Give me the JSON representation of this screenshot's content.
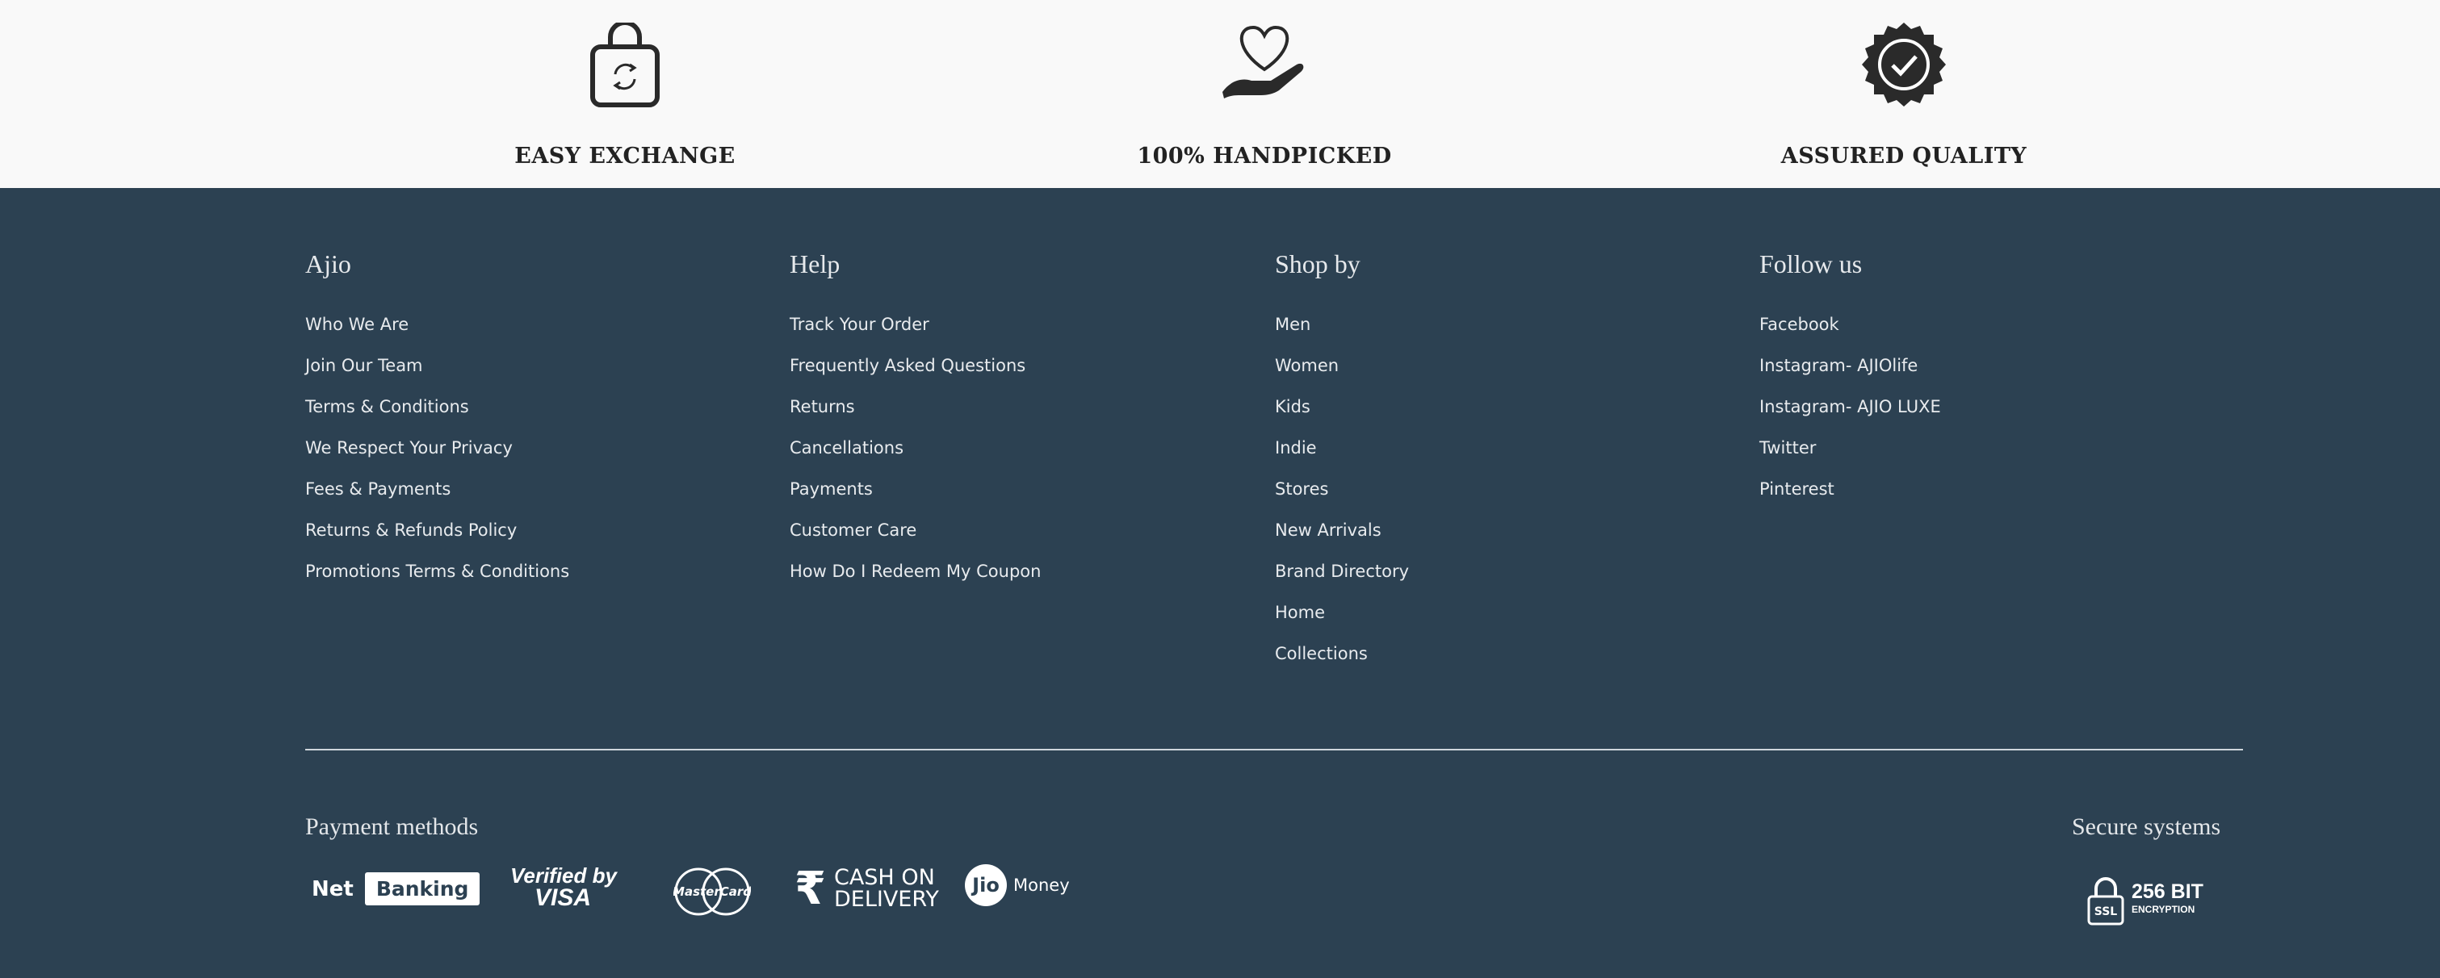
{
  "features": [
    {
      "label": "EASY EXCHANGE",
      "icon": "shopping-bag-exchange-icon"
    },
    {
      "label": "100% HANDPICKED",
      "icon": "heart-in-hand-icon"
    },
    {
      "label": "ASSURED QUALITY",
      "icon": "quality-badge-icon"
    }
  ],
  "footer": {
    "columns": [
      {
        "title": "Ajio",
        "items": [
          "Who We Are",
          "Join Our Team",
          "Terms & Conditions",
          "We Respect Your Privacy",
          "Fees & Payments",
          "Returns & Refunds Policy",
          "Promotions Terms & Conditions"
        ]
      },
      {
        "title": "Help",
        "items": [
          "Track Your Order",
          "Frequently Asked Questions",
          "Returns",
          "Cancellations",
          "Payments",
          "Customer Care",
          "How Do I Redeem My Coupon"
        ]
      },
      {
        "title": "Shop by",
        "items": [
          "Men",
          "Women",
          "Kids",
          "Indie",
          "Stores",
          "New Arrivals",
          "Brand Directory",
          "Home",
          "Collections"
        ]
      },
      {
        "title": "Follow us",
        "items": [
          "Facebook",
          "Instagram- AJIOlife",
          "Instagram- AJIO LUXE",
          "Twitter",
          "Pinterest"
        ]
      }
    ],
    "payment_title": "Payment methods",
    "secure_title": "Secure systems",
    "payments": {
      "net": "Net",
      "banking": "Banking",
      "visa_line1": "Verified by",
      "visa_line2": "VISA",
      "mastercard": "MasterCard",
      "cod_line1": "CASH ON",
      "cod_line2": "DELIVERY",
      "jio": "Jio",
      "jio_money": "Money"
    },
    "ssl": {
      "badge": "SSL",
      "bits": "256 BIT",
      "encryption": "ENCRYPTION"
    }
  },
  "colors": {
    "footer_bg": "#2c4152",
    "top_bg": "#f9f9f9"
  }
}
